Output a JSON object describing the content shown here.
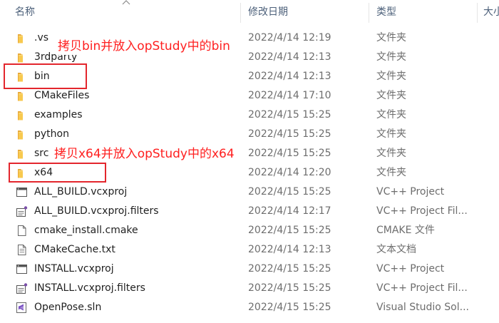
{
  "columns": {
    "name": "名称",
    "date": "修改日期",
    "type": "类型",
    "size": "大小"
  },
  "rows": [
    {
      "name": ".vs",
      "date": "2022/4/14 12:19",
      "type": "文件夹",
      "icon": "folder-icon"
    },
    {
      "name": "3rdparty",
      "date": "2022/4/14 12:13",
      "type": "文件夹",
      "icon": "folder-icon"
    },
    {
      "name": "bin",
      "date": "2022/4/14 12:13",
      "type": "文件夹",
      "icon": "folder-icon"
    },
    {
      "name": "CMakeFiles",
      "date": "2022/4/14 17:10",
      "type": "文件夹",
      "icon": "folder-icon"
    },
    {
      "name": "examples",
      "date": "2022/4/15 15:25",
      "type": "文件夹",
      "icon": "folder-icon"
    },
    {
      "name": "python",
      "date": "2022/4/15 15:25",
      "type": "文件夹",
      "icon": "folder-icon"
    },
    {
      "name": "src",
      "date": "2022/4/15 15:25",
      "type": "文件夹",
      "icon": "folder-icon"
    },
    {
      "name": "x64",
      "date": "2022/4/14 12:20",
      "type": "文件夹",
      "icon": "folder-icon"
    },
    {
      "name": "ALL_BUILD.vcxproj",
      "date": "2022/4/15 15:25",
      "type": "VC++ Project",
      "icon": "vcxproj-icon"
    },
    {
      "name": "ALL_BUILD.vcxproj.filters",
      "date": "2022/4/14 12:17",
      "type": "VC++ Project Fil...",
      "icon": "vcxproj-filters-icon"
    },
    {
      "name": "cmake_install.cmake",
      "date": "2022/4/15 15:25",
      "type": "CMAKE 文件",
      "icon": "file-icon"
    },
    {
      "name": "CMakeCache.txt",
      "date": "2022/4/14 12:13",
      "type": "文本文档",
      "icon": "text-file-icon"
    },
    {
      "name": "INSTALL.vcxproj",
      "date": "2022/4/15 15:25",
      "type": "VC++ Project",
      "icon": "vcxproj-icon"
    },
    {
      "name": "INSTALL.vcxproj.filters",
      "date": "2022/4/15 15:25",
      "type": "VC++ Project Fil...",
      "icon": "vcxproj-filters-icon"
    },
    {
      "name": "OpenPose.sln",
      "date": "2022/4/15 15:25",
      "type": "Visual Studio Sol...",
      "icon": "visual-studio-icon"
    }
  ],
  "annotations": {
    "bin_note": "拷贝bin并放入opStudy中的bin",
    "x64_note": "拷贝x64并放入opStudy中的x64"
  },
  "colors": {
    "annotation": "#e3262d",
    "folder": "#f8c94f",
    "header_text": "#4c607a",
    "secondary_text": "#6d6d6d"
  }
}
